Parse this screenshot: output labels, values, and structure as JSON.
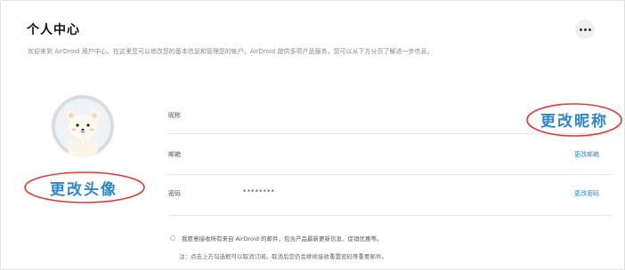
{
  "header": {
    "title": "个人中心",
    "subtitle": "欢迎来到 AirDroid 用户中心。在这里您可以修改您的基本信息和管理您的帐户。AirDroid 提供多项产品服务，您可以从下方分页了解进一步信息。"
  },
  "avatar": {
    "change_label": "更改头像"
  },
  "form": {
    "nickname": {
      "label": "昵称",
      "value": "",
      "action": "更改昵称"
    },
    "email": {
      "label": "邮箱",
      "value": "",
      "action": "更改邮箱"
    },
    "password": {
      "label": "密码",
      "value": "********",
      "action": "更改密码"
    }
  },
  "subscription": {
    "checkbox_label": "我愿意接收所有来自 AirDroid 的邮件，包含产品最新更新信息、促销优惠等。",
    "note": "注：点击上方勾选框可以取消订阅。取消后您仍会继续接收重置密码等重要邮件。"
  },
  "colors": {
    "accent": "#2f86c8",
    "annotation": "#e53935"
  }
}
